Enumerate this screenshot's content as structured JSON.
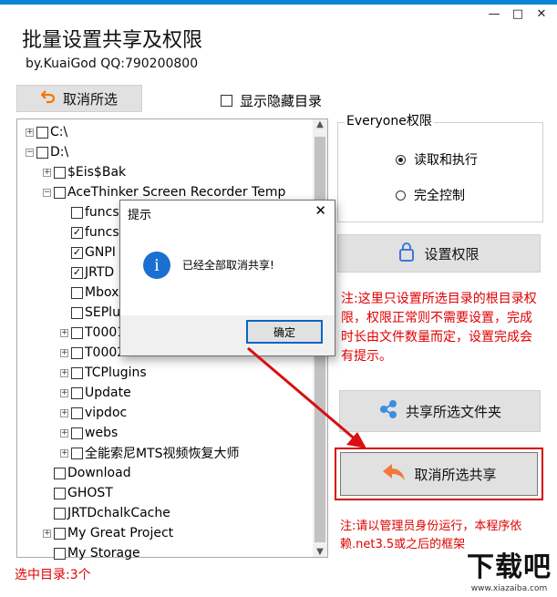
{
  "window": {
    "title": "批量设置共享及权限",
    "subtitle": "by.KuaiGod  QQ:790200800",
    "controls": [
      "—",
      "□",
      "✕"
    ]
  },
  "toolbar": {
    "cancel_select_label": "取消所选",
    "show_hidden_label": "显示隐藏目录"
  },
  "tree": {
    "nodes": [
      {
        "label": "C:\\",
        "expander": "+",
        "checked": false
      },
      {
        "label": "D:\\",
        "expander": "−",
        "checked": false
      },
      {
        "label": "$Eis$Bak",
        "expander": "+",
        "checked": false
      },
      {
        "label": "AceThinker Screen Recorder Temp",
        "expander": "−",
        "checked": false
      },
      {
        "label": "funcs",
        "expander": "",
        "checked": false
      },
      {
        "label": "funcs",
        "expander": "",
        "checked": true
      },
      {
        "label": "GNPI",
        "expander": "",
        "checked": true
      },
      {
        "label": "JRTD",
        "expander": "",
        "checked": true
      },
      {
        "label": "Mbox",
        "expander": "",
        "checked": false
      },
      {
        "label": "SEPlu",
        "expander": "",
        "checked": false
      },
      {
        "label": "T0001",
        "expander": "+",
        "checked": false
      },
      {
        "label": "T0002",
        "expander": "+",
        "checked": false
      },
      {
        "label": "TCPlugins",
        "expander": "+",
        "checked": false
      },
      {
        "label": "Update",
        "expander": "+",
        "checked": false
      },
      {
        "label": "vipdoc",
        "expander": "+",
        "checked": false
      },
      {
        "label": "webs",
        "expander": "+",
        "checked": false
      },
      {
        "label": "全能索尼MTS视频恢复大师",
        "expander": "+",
        "checked": false
      },
      {
        "label": "Download",
        "expander": "",
        "checked": false
      },
      {
        "label": "GHOST",
        "expander": "",
        "checked": false
      },
      {
        "label": "JRTDchalkCache",
        "expander": "",
        "checked": false
      },
      {
        "label": "My Great Project",
        "expander": "+",
        "checked": false
      },
      {
        "label": "My Storage",
        "expander": "",
        "checked": false
      }
    ]
  },
  "status": {
    "selected_count": "选中目录:3个"
  },
  "permissions": {
    "group_title": "Everyone权限",
    "options": [
      {
        "label": "读取和执行",
        "selected": true
      },
      {
        "label": "完全控制",
        "selected": false
      }
    ],
    "set_button_label": "设置权限",
    "note": "注:这里只设置所选目录的根目录权限，权限正常则不需要设置，完成时长由文件数量而定，设置完成会有提示。"
  },
  "actions": {
    "share_label": "共享所选文件夹",
    "cancel_share_label": "取消所选共享",
    "footer_note": "注:请以管理员身份运行，本程序依赖.net3.5或之后的框架"
  },
  "dialog": {
    "title": "提示",
    "message": "已经全部取消共享!",
    "ok_label": "确定"
  },
  "watermark": {
    "text": "下载吧",
    "url": "www.xiazaiba.com"
  },
  "colors": {
    "accent": "#0a84d6",
    "note_red": "#e00000",
    "highlight_border": "#d60000"
  }
}
